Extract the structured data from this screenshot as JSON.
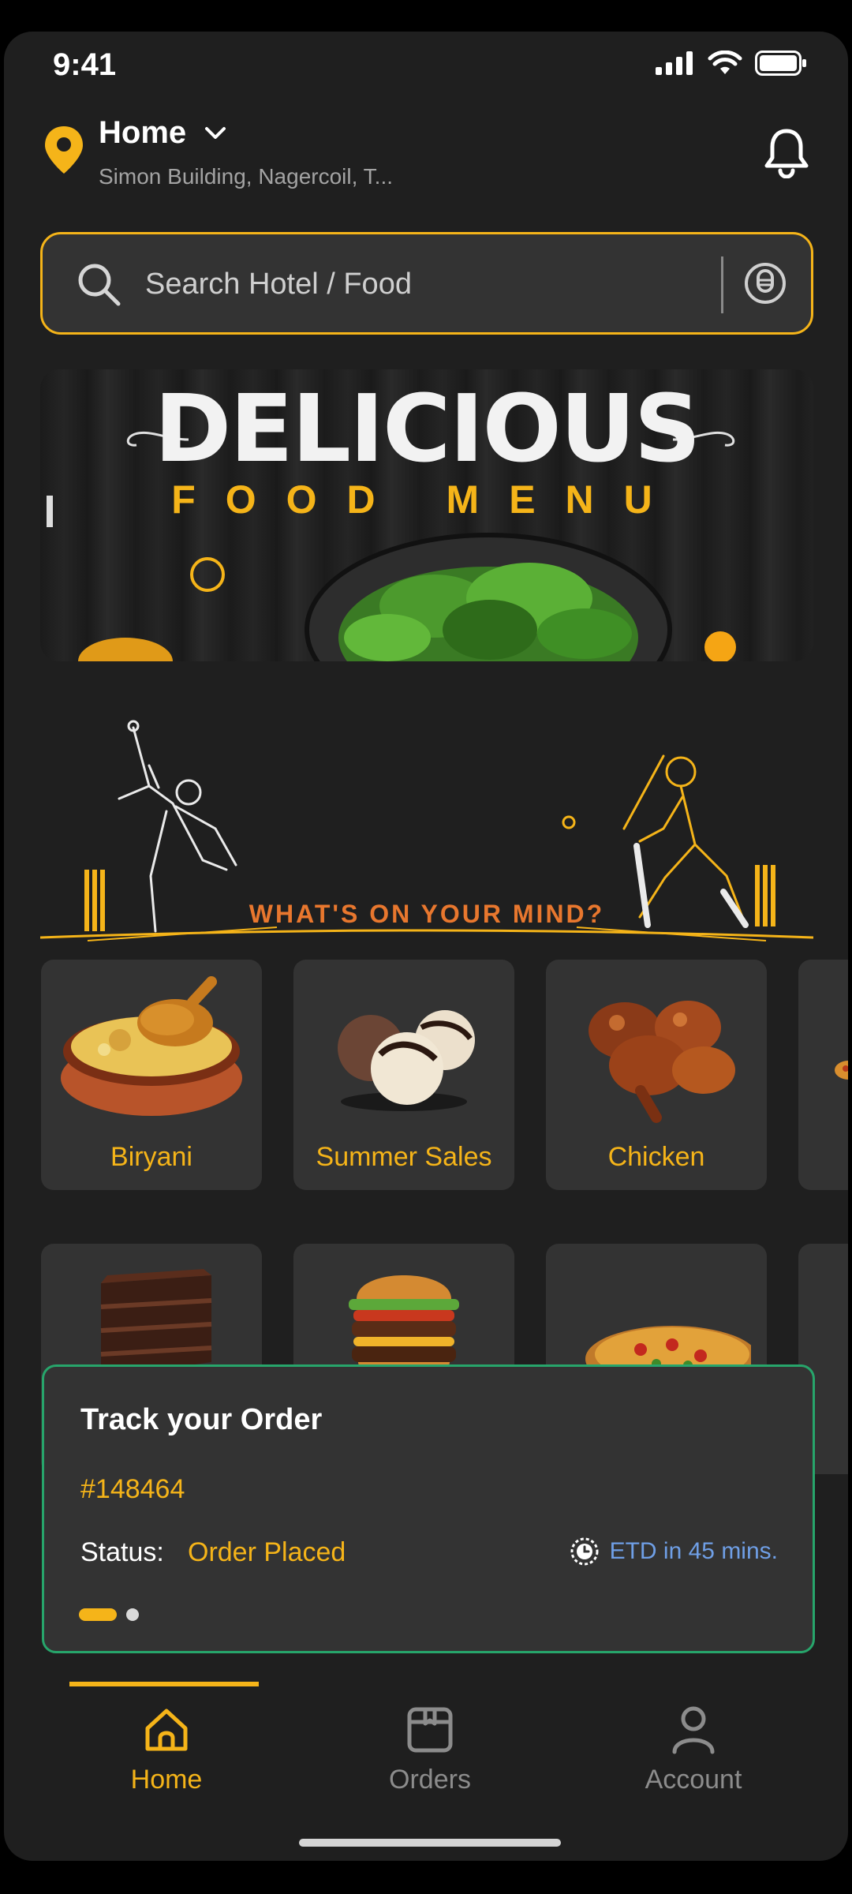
{
  "status_bar": {
    "time": "9:41"
  },
  "location": {
    "title": "Home",
    "subtitle": "Simon Building, Nagercoil, T..."
  },
  "search": {
    "placeholder": "Search Hotel / Food"
  },
  "banner": {
    "title": "DELICIOUS",
    "subtitle": "FOOD MENU"
  },
  "mind": {
    "heading": "WHAT'S ON YOUR MIND?"
  },
  "categories": [
    {
      "label": "Biryani",
      "icon": "biryani-image"
    },
    {
      "label": "Summer Sales",
      "icon": "ice-cream-image"
    },
    {
      "label": "Chicken",
      "icon": "chicken-image"
    },
    {
      "label": "",
      "icon": "cake-image"
    },
    {
      "label": "",
      "icon": "burger-image"
    },
    {
      "label": "",
      "icon": "pizza-image"
    }
  ],
  "track": {
    "title": "Track your Order",
    "order_id": "#148464",
    "status_label": "Status:",
    "status_value": "Order Placed",
    "etd": "ETD in 45 mins."
  },
  "nav": {
    "items": [
      {
        "label": "Home",
        "icon": "home-icon",
        "active": true
      },
      {
        "label": "Orders",
        "icon": "orders-icon",
        "active": false
      },
      {
        "label": "Account",
        "icon": "account-icon",
        "active": false
      }
    ]
  },
  "colors": {
    "accent": "#f5b419",
    "background": "#1f1f1f",
    "card": "#333333",
    "track_border": "#27a56b",
    "etd": "#6f9fe6",
    "mind_text": "#e8772e"
  }
}
